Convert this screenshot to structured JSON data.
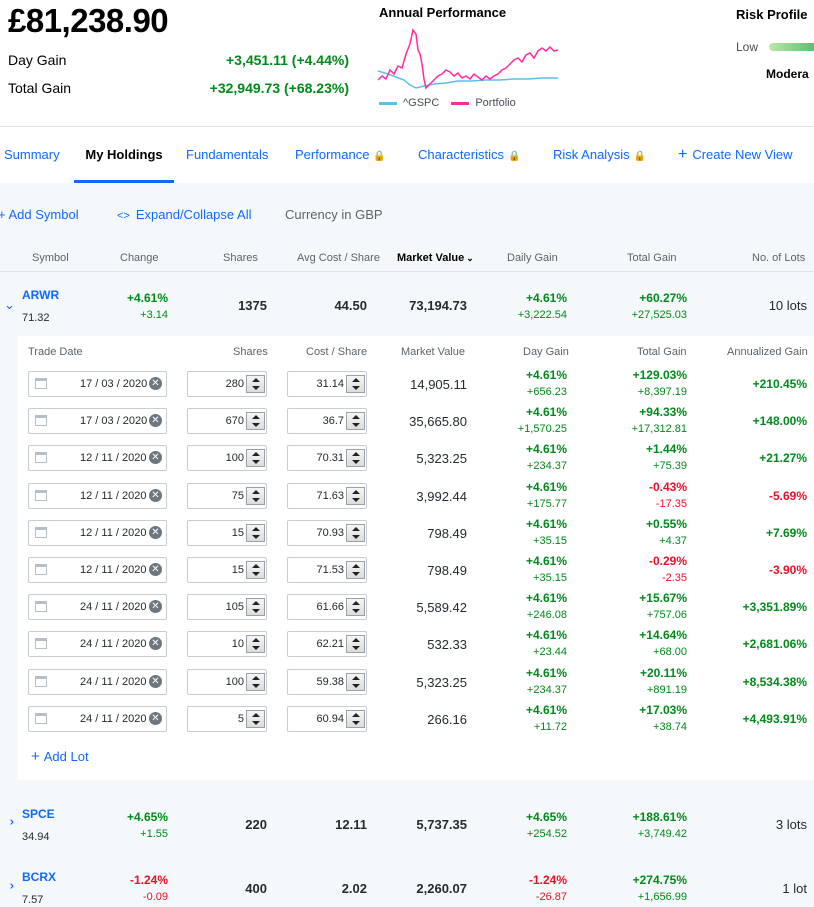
{
  "summary": {
    "total_value": "£81,238.90",
    "day_gain_label": "Day Gain",
    "day_gain_value": "+3,451.11 (+4.44%)",
    "total_gain_label": "Total Gain",
    "total_gain_value": "+32,949.73 (+68.23%)"
  },
  "performance": {
    "title": "Annual Performance",
    "legend": [
      {
        "name": "^GSPC",
        "color": "#5bc0ee"
      },
      {
        "name": "Portfolio",
        "color": "#ff2ba3"
      }
    ]
  },
  "risk": {
    "title": "Risk Profile",
    "low": "Low",
    "level": "Modera"
  },
  "tabs": [
    {
      "label": "Summary",
      "locked": false,
      "active": false
    },
    {
      "label": "My Holdings",
      "locked": false,
      "active": true
    },
    {
      "label": "Fundamentals",
      "locked": false,
      "active": false
    },
    {
      "label": "Performance",
      "locked": true,
      "active": false
    },
    {
      "label": "Characteristics",
      "locked": true,
      "active": false
    },
    {
      "label": "Risk Analysis",
      "locked": true,
      "active": false
    },
    {
      "label": "Create New View",
      "locked": false,
      "active": false
    }
  ],
  "toolbar": {
    "add_symbol": "Add Symbol",
    "expand_collapse": "Expand/Collapse All",
    "currency": "Currency in GBP"
  },
  "columns": [
    "Symbol",
    "Change",
    "Shares",
    "Avg Cost / Share",
    "Market Value",
    "Daily Gain",
    "Total Gain",
    "No. of Lots"
  ],
  "holdings": [
    {
      "symbol": "ARWR",
      "price": "71.32",
      "change_pct": "+4.61%",
      "change": "+3.14",
      "shares": "1375",
      "avg_cost": "44.50",
      "market_value": "73,194.73",
      "daily_pct": "+4.61%",
      "daily": "+3,222.54",
      "total_pct": "+60.27%",
      "total": "+27,525.03",
      "lots": "10 lots"
    },
    {
      "symbol": "SPCE",
      "price": "34.94",
      "change_pct": "+4.65%",
      "change": "+1.55",
      "shares": "220",
      "avg_cost": "12.11",
      "market_value": "5,737.35",
      "daily_pct": "+4.65%",
      "daily": "+254.52",
      "total_pct": "+188.61%",
      "total": "+3,749.42",
      "lots": "3 lots"
    },
    {
      "symbol": "BCRX",
      "price": "7.57",
      "change_pct": "-1.24%",
      "change": "-0.09",
      "shares": "400",
      "avg_cost": "2.02",
      "market_value": "2,260.07",
      "daily_pct": "-1.24%",
      "daily": "-26.87",
      "total_pct": "+274.75%",
      "total": "+1,656.99",
      "lots": "1 lot"
    }
  ],
  "lot_columns": [
    "Trade Date",
    "Shares",
    "Cost / Share",
    "Market Value",
    "Day Gain",
    "Total Gain",
    "Annualized Gain"
  ],
  "lots": [
    {
      "date": "17 / 03 / 2020",
      "shares": "280",
      "cost": "31.14",
      "mv": "14,905.11",
      "day_pct": "+4.61%",
      "day": "+656.23",
      "tot_pct": "+129.03%",
      "tot": "+8,397.19",
      "ann": "+210.45%"
    },
    {
      "date": "17 / 03 / 2020",
      "shares": "670",
      "cost": "36.7",
      "mv": "35,665.80",
      "day_pct": "+4.61%",
      "day": "+1,570.25",
      "tot_pct": "+94.33%",
      "tot": "+17,312.81",
      "ann": "+148.00%"
    },
    {
      "date": "12 / 11 / 2020",
      "shares": "100",
      "cost": "70.31",
      "mv": "5,323.25",
      "day_pct": "+4.61%",
      "day": "+234.37",
      "tot_pct": "+1.44%",
      "tot": "+75.39",
      "ann": "+21.27%"
    },
    {
      "date": "12 / 11 / 2020",
      "shares": "75",
      "cost": "71.63",
      "mv": "3,992.44",
      "day_pct": "+4.61%",
      "day": "+175.77",
      "tot_pct": "-0.43%",
      "tot": "-17.35",
      "ann": "-5.69%"
    },
    {
      "date": "12 / 11 / 2020",
      "shares": "15",
      "cost": "70.93",
      "mv": "798.49",
      "day_pct": "+4.61%",
      "day": "+35.15",
      "tot_pct": "+0.55%",
      "tot": "+4.37",
      "ann": "+7.69%"
    },
    {
      "date": "12 / 11 / 2020",
      "shares": "15",
      "cost": "71.53",
      "mv": "798.49",
      "day_pct": "+4.61%",
      "day": "+35.15",
      "tot_pct": "-0.29%",
      "tot": "-2.35",
      "ann": "-3.90%"
    },
    {
      "date": "24 / 11 / 2020",
      "shares": "105",
      "cost": "61.66",
      "mv": "5,589.42",
      "day_pct": "+4.61%",
      "day": "+246.08",
      "tot_pct": "+15.67%",
      "tot": "+757.06",
      "ann": "+3,351.89%"
    },
    {
      "date": "24 / 11 / 2020",
      "shares": "10",
      "cost": "62.21",
      "mv": "532.33",
      "day_pct": "+4.61%",
      "day": "+23.44",
      "tot_pct": "+14.64%",
      "tot": "+68.00",
      "ann": "+2,681.06%"
    },
    {
      "date": "24 / 11 / 2020",
      "shares": "100",
      "cost": "59.38",
      "mv": "5,323.25",
      "day_pct": "+4.61%",
      "day": "+234.37",
      "tot_pct": "+20.11%",
      "tot": "+891.19",
      "ann": "+8,534.38%"
    },
    {
      "date": "24 / 11 / 2020",
      "shares": "5",
      "cost": "60.94",
      "mv": "266.16",
      "day_pct": "+4.61%",
      "day": "+11.72",
      "tot_pct": "+17.03%",
      "tot": "+38.74",
      "ann": "+4,493.91%"
    }
  ],
  "add_lot": "Add Lot"
}
